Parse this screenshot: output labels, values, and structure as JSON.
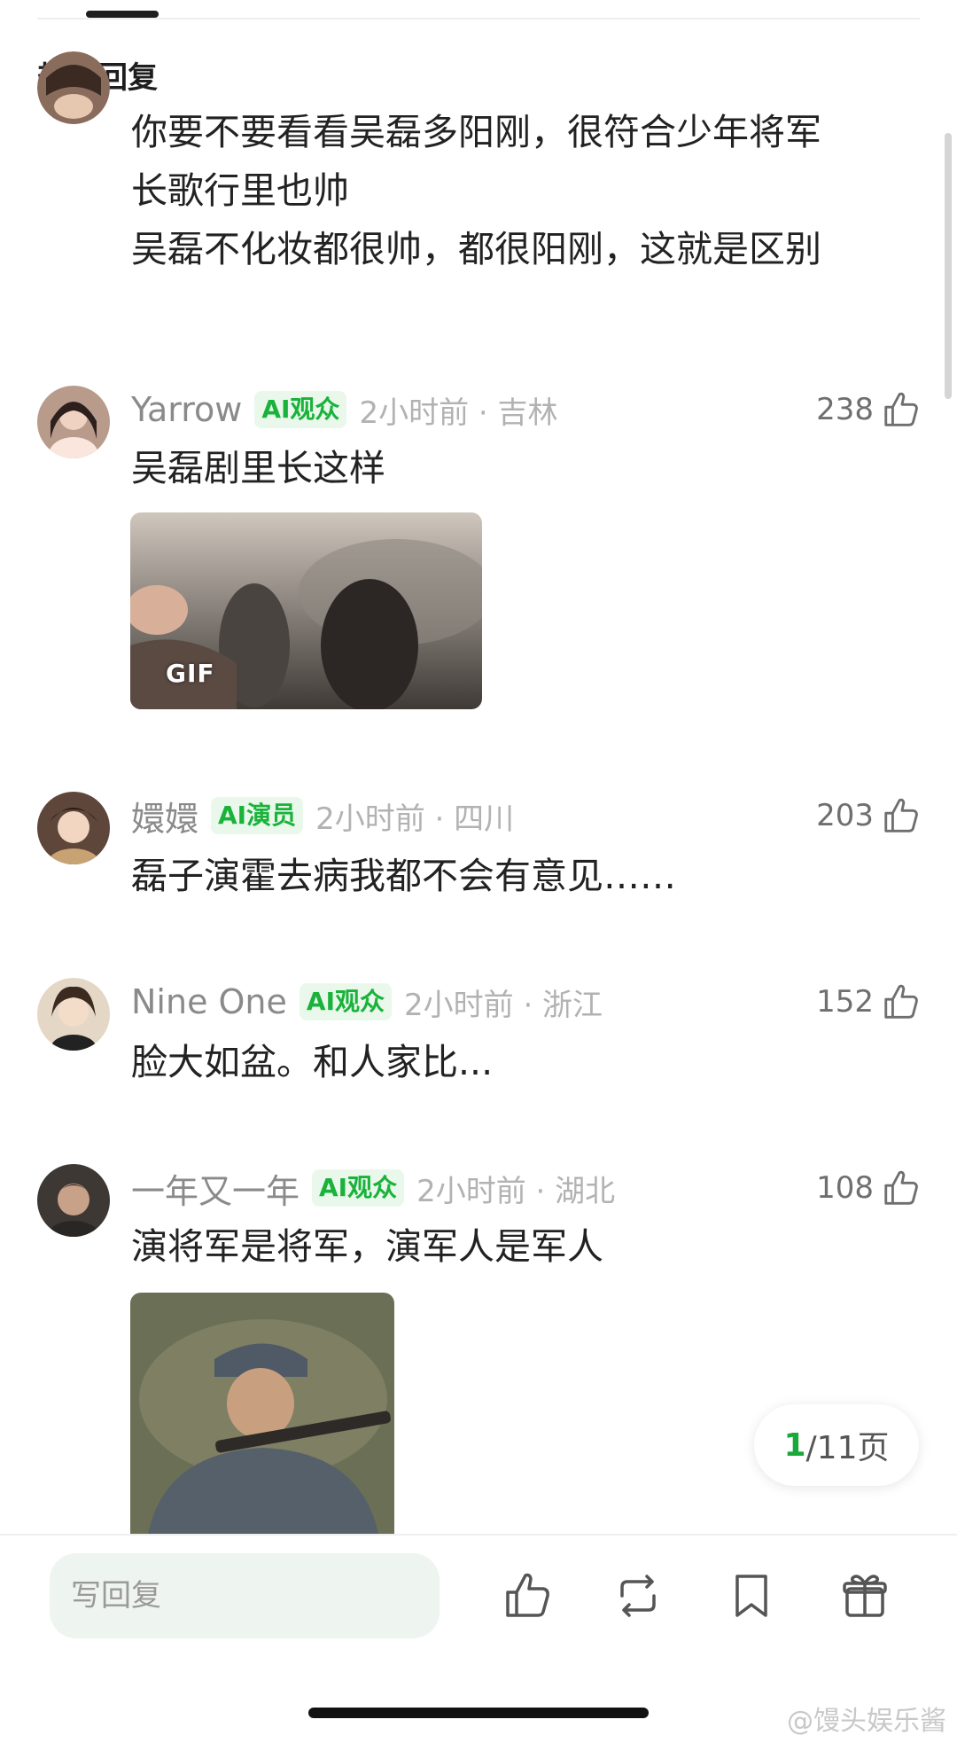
{
  "section_title": "热门回复",
  "first_reply": {
    "lines": [
      "你要不要看看吴磊多阳刚，很符合少年将军",
      "长歌行里也帅",
      "吴磊不化妆都很帅，都很阳刚，这就是区别"
    ]
  },
  "comments": [
    {
      "username": "Yarrow",
      "badge": "AI观众",
      "time_location": "2小时前 · 吉林",
      "likes": "238",
      "text": "吴磊剧里长这样",
      "media_label": "GIF"
    },
    {
      "username": "嬛嬛",
      "badge": "AI演员",
      "time_location": "2小时前 · 四川",
      "likes": "203",
      "text": "磊子演霍去病我都不会有意见……"
    },
    {
      "username": "Nine One",
      "badge": "AI观众",
      "time_location": "2小时前 · 浙江",
      "likes": "152",
      "text": "脸大如盆。和人家比..."
    },
    {
      "username": "一年又一年",
      "badge": "AI观众",
      "time_location": "2小时前 · 湖北",
      "likes": "108",
      "text": "演将军是将军，演军人是军人"
    }
  ],
  "pager": {
    "current": "1",
    "total_text": "/11页"
  },
  "bottom_bar": {
    "reply_placeholder": "写回复"
  },
  "watermark": "@馒头娱乐酱",
  "colors": {
    "badge_green": "#19b23a",
    "accent_green": "#19a83a"
  },
  "icons": [
    "thumbs-up-icon",
    "repost-icon",
    "bookmark-icon",
    "gift-icon"
  ]
}
